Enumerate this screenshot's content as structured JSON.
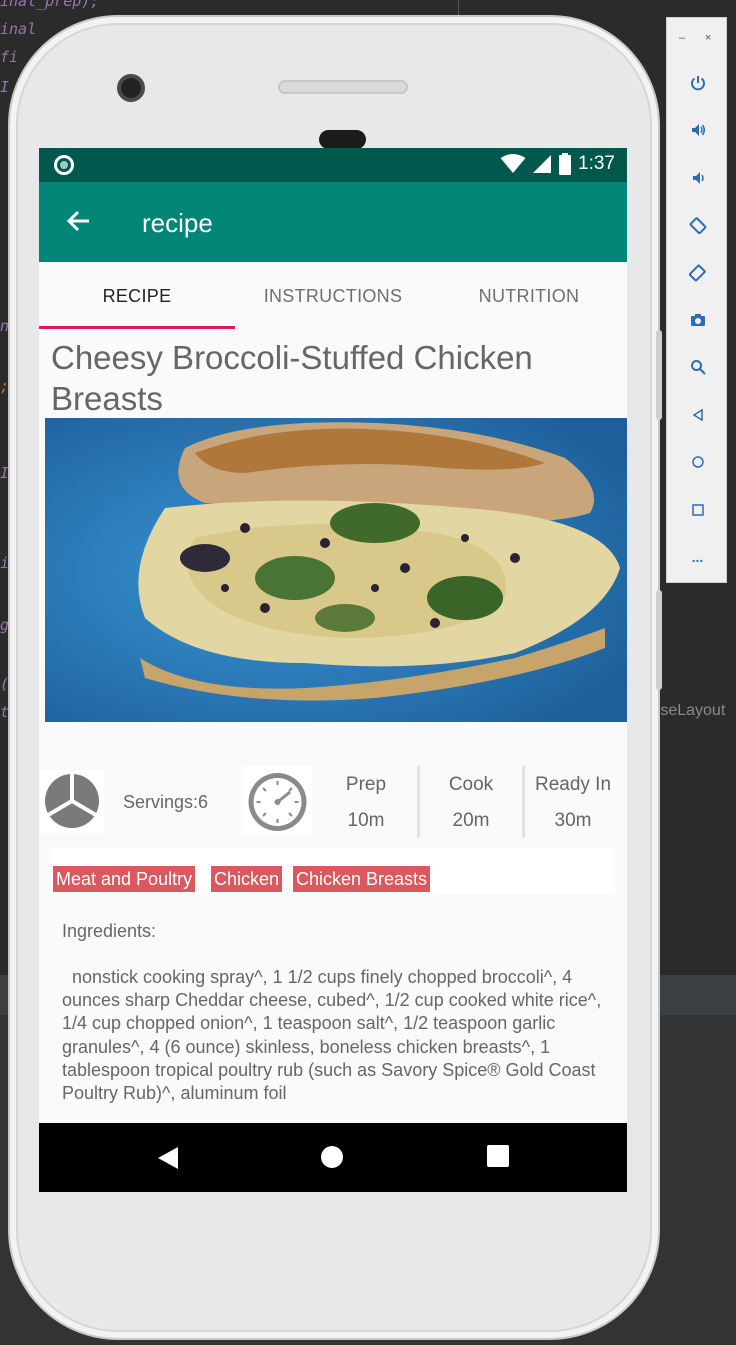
{
  "ide": {
    "code_lines": [
      "inal_prep);",
      "inal",
      "fi",
      "I",
      "n",
      ";",
      "I",
      "i",
      "g",
      "(",
      "t"
    ],
    "layout_hint": "rseLayout"
  },
  "emulator_toolbar": {
    "minimize": "–",
    "close": "×",
    "buttons": [
      "power-icon",
      "volume-up-icon",
      "volume-down-icon",
      "rotate-left-icon",
      "rotate-right-icon",
      "camera-icon",
      "zoom-icon",
      "back-icon",
      "home-icon",
      "overview-icon",
      "more-icon"
    ],
    "more_label": "..."
  },
  "status_bar": {
    "time": "1:37",
    "background": "#00574b"
  },
  "app_bar": {
    "title": "recipe",
    "background": "#008577"
  },
  "tabs": [
    {
      "label": "RECIPE",
      "active": true
    },
    {
      "label": "INSTRUCTIONS",
      "active": false
    },
    {
      "label": "NUTRITION",
      "active": false
    }
  ],
  "recipe": {
    "title": "Cheesy Broccoli-Stuffed Chicken Breasts",
    "servings": "Servings:6",
    "prep": {
      "label": "Prep",
      "value": "10m"
    },
    "cook": {
      "label": "Cook",
      "value": "20m"
    },
    "ready": {
      "label": "Ready In",
      "value": "30m"
    },
    "tags": [
      "Meat and Poultry",
      "Chicken",
      "Chicken Breasts"
    ],
    "ingredients_label": "Ingredients:",
    "ingredients_text": "nonstick cooking spray^, 1 1/2 cups finely chopped broccoli^, 4 ounces sharp Cheddar cheese, cubed^, 1/2 cup cooked white rice^, 1/4 cup chopped onion^, 1 teaspoon salt^, 1/2 teaspoon garlic granules^, 4 (6 ounce) skinless, boneless chicken breasts^, 1 tablespoon tropical poultry rub (such as Savory Spice® Gold Coast Poultry Rub)^, aluminum foil"
  },
  "colors": {
    "accent": "#d81b60",
    "tag": "#d9595e"
  },
  "nav_bar": {
    "buttons": [
      "back-triangle-icon",
      "home-circle-icon",
      "recents-square-icon"
    ]
  }
}
